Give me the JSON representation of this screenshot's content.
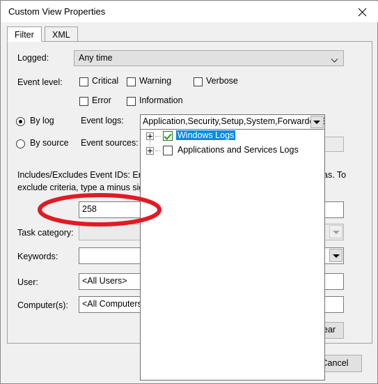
{
  "window": {
    "title": "Custom View Properties",
    "close_icon": "close-icon"
  },
  "tabs": [
    {
      "label": "Filter",
      "active": true
    },
    {
      "label": "XML",
      "active": false
    }
  ],
  "filter_tab": {
    "logged": {
      "label": "Logged:",
      "value": "Any time",
      "chevron_icon": "chevron-down-icon"
    },
    "event_level": {
      "label": "Event level:",
      "checkboxes": [
        {
          "label": "Critical",
          "mnemonic": "l",
          "checked": false
        },
        {
          "label": "Warning",
          "mnemonic": "W",
          "checked": false
        },
        {
          "label": "Verbose",
          "mnemonic": "b",
          "checked": false
        },
        {
          "label": "Error",
          "mnemonic": "r",
          "checked": false
        },
        {
          "label": "Information",
          "mnemonic": "I",
          "checked": false
        }
      ]
    },
    "source_mode": {
      "by_log": {
        "label": "By log",
        "mnemonic": "o",
        "selected": true
      },
      "by_source": {
        "label": "By source",
        "mnemonic": "s",
        "selected": false
      }
    },
    "event_logs": {
      "label": "Event logs:",
      "mnemonic": "E",
      "value": "Application,Security,Setup,System,Forwarded E",
      "dropdown_icon": "dropdown-arrow-icon"
    },
    "event_sources": {
      "label": "Event sources:",
      "mnemonic": "v",
      "value": ""
    },
    "event_ids": {
      "description_line1": "Includes/Excludes Event IDs: Enter",
      "description_line1_tail": "as. To",
      "description_line2": "exclude criteria, type a minus sign",
      "value": "258"
    },
    "task_category": {
      "label": "Task category:",
      "mnemonic": "T",
      "value": "",
      "dropdown_icon": "dropdown-arrow-icon"
    },
    "keywords": {
      "label": "Keywords:",
      "mnemonic": "K",
      "value": "",
      "dropdown_icon": "dropdown-arrow-icon"
    },
    "user": {
      "label": "User:",
      "mnemonic": "U",
      "value": "<All Users>"
    },
    "computers": {
      "label": "Computer(s):",
      "mnemonic": "p",
      "value": "<All Computers"
    },
    "clear_button": {
      "visible_label": "ear",
      "full_label": "Clear",
      "mnemonic": "a"
    }
  },
  "event_logs_popup": {
    "items": [
      {
        "label": "Windows Logs",
        "checked": true,
        "selected": true,
        "expander_icon": "plus-expander-icon",
        "checkbox_icon": "checkbox-checked-icon"
      },
      {
        "label": "Applications and Services Logs",
        "checked": false,
        "selected": false,
        "expander_icon": "plus-expander-icon",
        "checkbox_icon": "checkbox-unchecked-icon"
      }
    ]
  },
  "footer": {
    "cancel_label": "Cancel"
  },
  "annotation": {
    "shape": "ellipse",
    "color": "#e01b24",
    "target": "258"
  },
  "colors": {
    "dialog_bg": "#f0f0f0",
    "titlebar_bg": "#ffffff",
    "selection_blue": "#0a8ae8",
    "check_green": "#1f9a1f",
    "annotation_red": "#e01b24"
  }
}
